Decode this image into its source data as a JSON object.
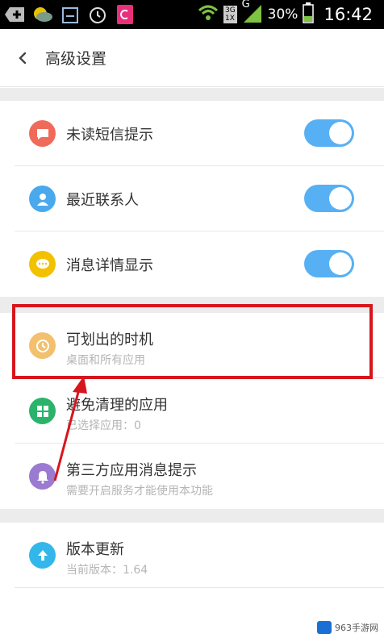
{
  "status_bar": {
    "network": "3G",
    "network_alt": "1X",
    "signal_letter": "G",
    "battery": "30%",
    "time": "16:42"
  },
  "header": {
    "title": "高级设置"
  },
  "items": [
    {
      "label": "未读短信提示",
      "icon": "message-icon",
      "color": "#f06a5a",
      "toggle": true
    },
    {
      "label": "最近联系人",
      "icon": "contact-icon",
      "color": "#4aa9ec",
      "toggle": true
    },
    {
      "label": "消息详情显示",
      "icon": "chat-icon",
      "color": "#f2c100",
      "toggle": true
    },
    {
      "label": "可划出的时机",
      "sub": "桌面和所有应用",
      "icon": "clock-icon",
      "color": "#f2c06e"
    },
    {
      "label": "避免清理的应用",
      "sub": "已选择应用：0",
      "icon": "apps-icon",
      "color": "#2cb36b"
    },
    {
      "label": "第三方应用消息提示",
      "sub": "需要开启服务才能使用本功能",
      "icon": "bell-icon",
      "color": "#9b7ad1"
    },
    {
      "label": "版本更新",
      "sub": "当前版本：1.64",
      "icon": "upload-icon",
      "color": "#33b7ea"
    }
  ],
  "annotation_color": "#d7151c",
  "watermark": "963手游网"
}
